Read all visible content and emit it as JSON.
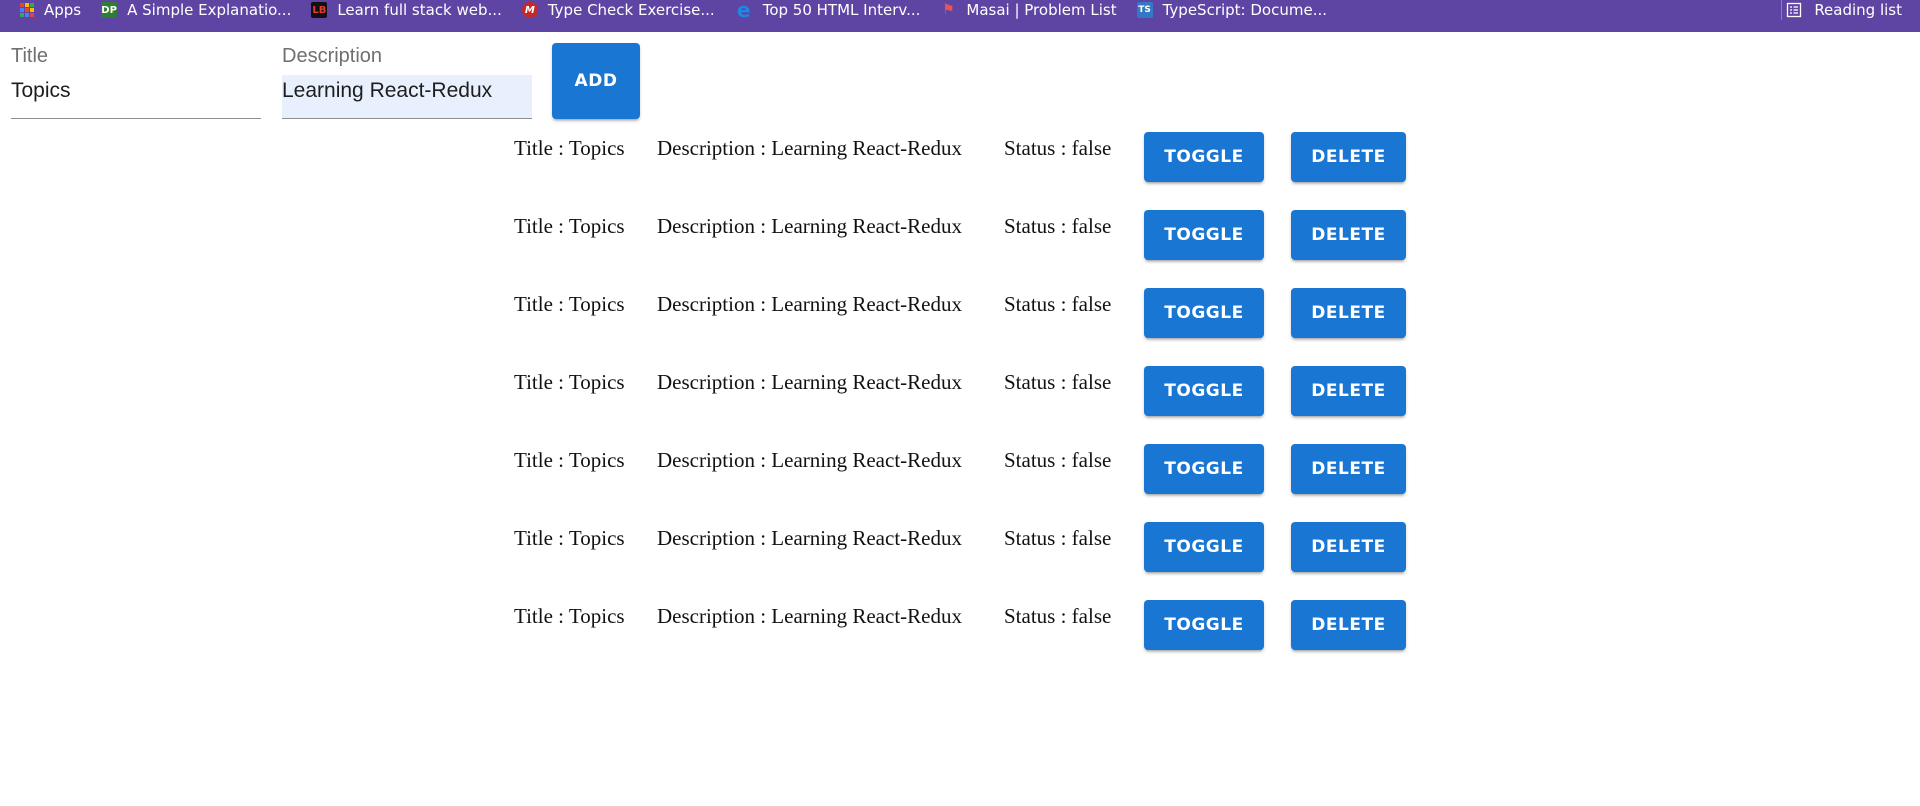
{
  "bookmarks_bar": {
    "items": [
      {
        "label": "Apps",
        "icon": "apps-grid-icon"
      },
      {
        "label": "A Simple Explanatio...",
        "icon": "dp-icon",
        "badge": "DP",
        "badge_color": "#2e7d32"
      },
      {
        "label": "Learn full stack web...",
        "icon": "lb-icon",
        "badge": "LB",
        "badge_color": "#111111"
      },
      {
        "label": "Type Check Exercise...",
        "icon": "m-icon",
        "badge": "M",
        "badge_color": "#c62828"
      },
      {
        "label": "Top 50 HTML Interv...",
        "icon": "e-icon",
        "badge": "e",
        "badge_color": "#1565c0"
      },
      {
        "label": "Masai | Problem List",
        "icon": "masai-icon",
        "badge": "⚑",
        "badge_color": "#b71c1c"
      },
      {
        "label": "TypeScript: Docume...",
        "icon": "ts-icon",
        "badge": "TS",
        "badge_color": "#3178c6"
      }
    ],
    "reading_list": {
      "label": "Reading list",
      "icon": "reading-list-icon"
    }
  },
  "form": {
    "title": {
      "label": "Title",
      "value": "Topics"
    },
    "description": {
      "label": "Description",
      "value": "Learning React-Redux"
    },
    "add_label": "ADD"
  },
  "todos": [
    {
      "title": "Title : Topics",
      "description": "Description : Learning React-Redux",
      "status": "Status : false",
      "toggle_label": "TOGGLE",
      "delete_label": "DELETE"
    },
    {
      "title": "Title : Topics",
      "description": "Description : Learning React-Redux",
      "status": "Status : false",
      "toggle_label": "TOGGLE",
      "delete_label": "DELETE"
    },
    {
      "title": "Title : Topics",
      "description": "Description : Learning React-Redux",
      "status": "Status : false",
      "toggle_label": "TOGGLE",
      "delete_label": "DELETE"
    },
    {
      "title": "Title : Topics",
      "description": "Description : Learning React-Redux",
      "status": "Status : false",
      "toggle_label": "TOGGLE",
      "delete_label": "DELETE"
    },
    {
      "title": "Title : Topics",
      "description": "Description : Learning React-Redux",
      "status": "Status : false",
      "toggle_label": "TOGGLE",
      "delete_label": "DELETE"
    },
    {
      "title": "Title : Topics",
      "description": "Description : Learning React-Redux",
      "status": "Status : false",
      "toggle_label": "TOGGLE",
      "delete_label": "DELETE"
    },
    {
      "title": "Title : Topics",
      "description": "Description : Learning React-Redux",
      "status": "Status : false",
      "toggle_label": "TOGGLE",
      "delete_label": "DELETE"
    }
  ],
  "colors": {
    "bookmarks_bar": "#5e45a3",
    "primary_button": "#1976d2",
    "autofill_background": "#e8f0fe"
  }
}
